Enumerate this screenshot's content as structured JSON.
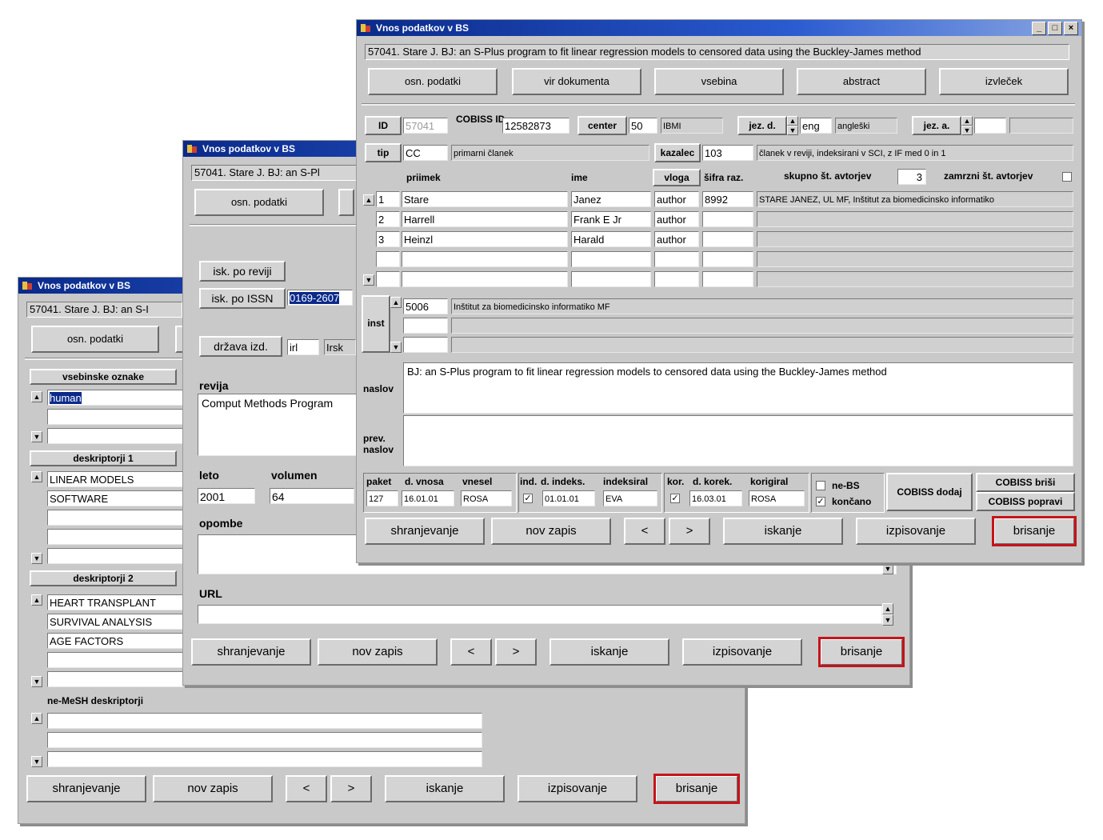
{
  "window_title": "Vnos podatkov v BS",
  "record_line": "57041. Stare J. BJ: an S-Plus program to fit linear regression models to censored data using the Buckley-James method",
  "record_line_short_1": "57041. Stare J. BJ: an S-Pl",
  "record_line_short_2": "57041. Stare J. BJ: an S-I",
  "tabs": [
    "osn. podatki",
    "vir dokumenta",
    "vsebina",
    "abstract",
    "izvleček"
  ],
  "actions": {
    "save": "shranjevanje",
    "new": "nov zapis",
    "prev": "<",
    "next": ">",
    "search": "iskanje",
    "print": "izpisovanje",
    "delete": "brisanje"
  },
  "win_back": {
    "subject_label": "vsebinske oznake",
    "subject_values": [
      "human"
    ],
    "desc1_label": "deskriptorji 1",
    "desc1_values": [
      "LINEAR MODELS",
      "SOFTWARE"
    ],
    "desc2_label": "deskriptorji 2",
    "desc2_values": [
      "HEART TRANSPLANT",
      "SURVIVAL ANALYSIS",
      "AGE FACTORS"
    ],
    "nonmesh_label": "ne-MeSH deskriptorji"
  },
  "win_mid": {
    "search_journal": "isk. po reviji",
    "search_issn": "isk. po ISSN",
    "issn_value": "0169-2607",
    "country_label": "država izd.",
    "country_code": "irl",
    "country_name": "Irsk",
    "journal_label": "revija",
    "journal_value": "Comput Methods Program",
    "year_label": "leto",
    "year_value": "2001",
    "volume_label": "volumen",
    "volume_value": "64",
    "notes_label": "opombe",
    "url_label": "URL"
  },
  "win_front": {
    "id_label": "ID",
    "id_value": "57041",
    "cobiss_label": "COBISS ID",
    "cobiss_value": "12582873",
    "center_label": "center",
    "center_code": "50",
    "center_name": "IBMI",
    "lang_d_label": "jez. d.",
    "lang_d_code": "eng",
    "lang_d_name": "angleški",
    "lang_a_label": "jez. a.",
    "type_label": "tip",
    "type_code": "CC",
    "type_name": "primarni članek",
    "indicator_label": "kazalec",
    "indicator_code": "103",
    "indicator_desc": "članek v reviji, indeksirani v SCI, z IF med 0 in 1",
    "col_surname": "priimek",
    "col_name": "ime",
    "col_role": "vloga",
    "col_code": "šifra raz.",
    "total_authors_label": "skupno št. avtorjev",
    "total_authors_value": "3",
    "freeze_label": "zamrzni št. avtorjev",
    "authors": [
      {
        "no": "1",
        "surname": "Stare",
        "name": "Janez",
        "role": "author",
        "code": "8992",
        "desc": "STARE JANEZ, UL MF, Inštitut za biomedicinsko informatiko"
      },
      {
        "no": "2",
        "surname": "Harrell",
        "name": "Frank E Jr",
        "role": "author",
        "code": "",
        "desc": ""
      },
      {
        "no": "3",
        "surname": "Heinzl",
        "name": "Harald",
        "role": "author",
        "code": "",
        "desc": ""
      }
    ],
    "inst_label": "inst",
    "inst_code": "5006",
    "inst_name": "Inštitut za biomedicinsko informatiko MF",
    "title_label": "naslov",
    "title_value": "BJ: an S-Plus program to fit linear regression models to censored data using the Buckley-James method",
    "trans_title_label": "prev. naslov",
    "paket_label": "paket",
    "date_entry_label": "d. vnosa",
    "entered_by_label": "vnesel",
    "paket_value": "127",
    "date_entry_value": "16.01.01",
    "entered_by_value": "ROSA",
    "index_label": "ind.",
    "date_index_label": "d. indeks.",
    "indexed_by_label": "indeksiral",
    "date_index_value": "01.01.01",
    "indexed_by_value": "EVA",
    "corr_label": "kor.",
    "date_corr_label": "d. korek.",
    "corrected_by_label": "korigiral",
    "date_corr_value": "16.03.01",
    "corrected_by_value": "ROSA",
    "nebs_label": "ne-BS",
    "finished_label": "končano",
    "cobiss_add": "COBISS dodaj",
    "cobiss_delete": "COBISS briši",
    "cobiss_fix": "COBISS popravi"
  }
}
